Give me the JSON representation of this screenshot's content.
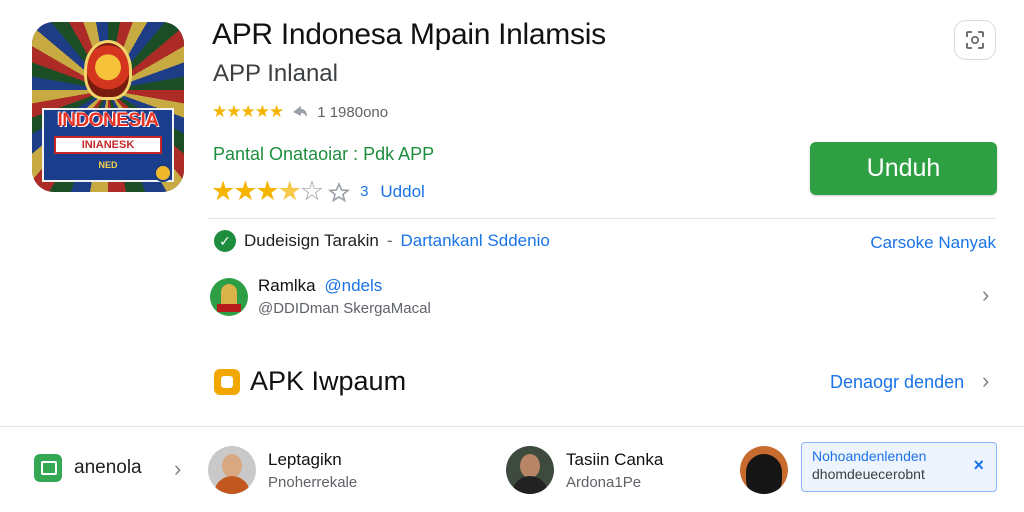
{
  "app": {
    "title": "APR Indonesa Mpain Inlamsis",
    "subtitle": "APP Inlanal",
    "icon_text_main": "INDONESIA",
    "icon_text_banner": "INIANESK",
    "icon_text_small": "NED",
    "rating_small": "1 1980ono",
    "developer_line": "Pantal Onataoiar : Pdk APP",
    "rating_big_count": "3",
    "rating_big_label": "Uddol",
    "install_label": "Unduh"
  },
  "verified": {
    "text": "Dudeisign Tarakin",
    "separator": "-",
    "link": "Dartankanl Sddenio",
    "more": "Carsoke Nanyak"
  },
  "developer": {
    "name": "Ramlka",
    "handle": "@ndels",
    "sub": "@DDIDman SkergaMacal"
  },
  "section": {
    "title": "APK Iwpaum",
    "see_all": "Denaogr denden"
  },
  "bottom": {
    "side_label": "anenola",
    "people": [
      {
        "name": "Leptagikn",
        "sub": "Pnoherrekale"
      },
      {
        "name": "Tasiin Canka",
        "sub": "Ardona1Pe"
      }
    ],
    "toast": {
      "line1": "Nohoandenlenden",
      "line2": "dhomdeuecerobnt",
      "close": "×"
    }
  },
  "icons": {
    "app_icon": "indonesia-app-icon",
    "top_right": "scan-icon",
    "share": "share-icon",
    "verified": "check-circle-icon",
    "apk": "apk-icon",
    "side": "image-icon"
  },
  "colors": {
    "install": "#2ea043",
    "link": "#1a73e8",
    "star": "#f5b400",
    "developer_green": "#1e8e3e"
  }
}
